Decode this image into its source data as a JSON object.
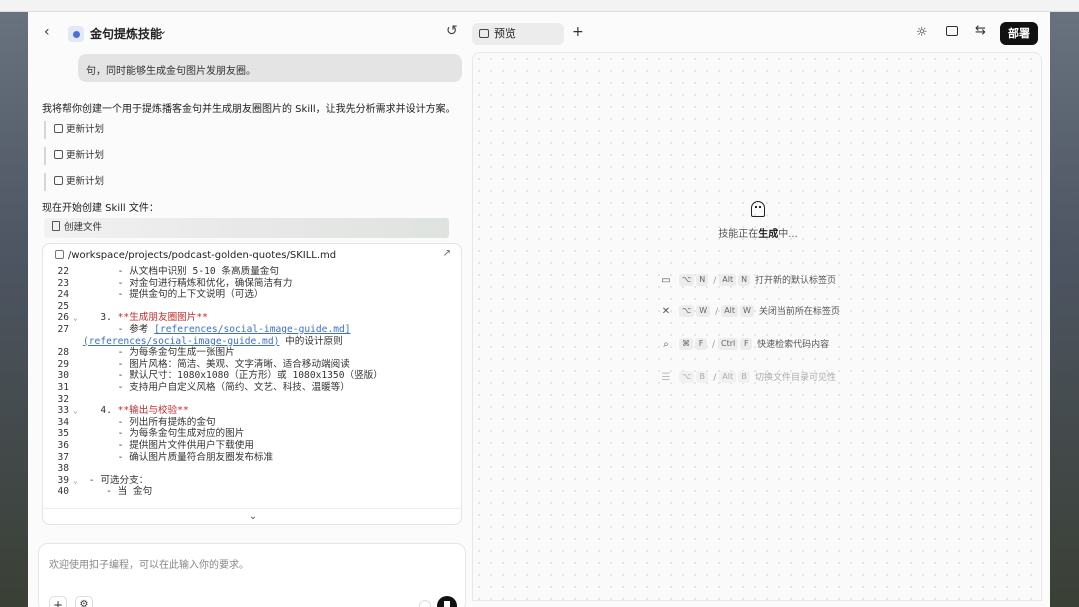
{
  "window": {
    "skill_title": "金句提炼技能"
  },
  "chat": {
    "user_bubble": "句，同时能够生成金句图片发朋友圈。",
    "assistant_text": "我将帮你创建一个用于提炼播客金句并生成朋友圈图片的 Skill，让我先分析需求并设计方案。",
    "plan_items": [
      "更新计划",
      "更新计划",
      "更新计划"
    ],
    "start_text": "现在开始创建 Skill 文件：",
    "create_file": "创建文件"
  },
  "code": {
    "file_path": "/workspace/projects/podcast-golden-quotes/SKILL.md",
    "lines": [
      {
        "n": "22",
        "fold": "",
        "text": "      - 从文档中识别 5-10 条高质量金句"
      },
      {
        "n": "23",
        "fold": "",
        "text": "      - 对金句进行精炼和优化，确保简洁有力"
      },
      {
        "n": "24",
        "fold": "",
        "text": "      - 提供金句的上下文说明（可选）"
      },
      {
        "n": "25",
        "fold": "",
        "text": ""
      },
      {
        "n": "26",
        "fold": "⌄",
        "pre": "   3. ",
        "md": "**生成朋友圈图片**",
        "text": ""
      },
      {
        "n": "27",
        "fold": "",
        "pre": "      - 参考 ",
        "link": "[references/social-image-guide.md]",
        "text": ""
      },
      {
        "n": "",
        "fold": "",
        "pre": "",
        "link": "(references/social-image-guide.md)",
        "text": " 中的设计原则"
      },
      {
        "n": "28",
        "fold": "",
        "text": "      - 为每条金句生成一张图片"
      },
      {
        "n": "29",
        "fold": "",
        "text": "      - 图片风格：简洁、美观、文字清晰、适合移动端阅读"
      },
      {
        "n": "30",
        "fold": "",
        "text": "      - 默认尺寸：1080x1080（正方形）或 1080x1350（竖版）"
      },
      {
        "n": "31",
        "fold": "",
        "text": "      - 支持用户自定义风格（简约、文艺、科技、温暖等）"
      },
      {
        "n": "32",
        "fold": "",
        "text": ""
      },
      {
        "n": "33",
        "fold": "⌄",
        "pre": "   4. ",
        "md": "**输出与校验**",
        "text": ""
      },
      {
        "n": "34",
        "fold": "",
        "text": "      - 列出所有提炼的金句"
      },
      {
        "n": "35",
        "fold": "",
        "text": "      - 为每条金句生成对应的图片"
      },
      {
        "n": "36",
        "fold": "",
        "text": "      - 提供图片文件供用户下载使用"
      },
      {
        "n": "37",
        "fold": "",
        "text": "      - 确认图片质量符合朋友圈发布标准"
      },
      {
        "n": "38",
        "fold": "",
        "text": ""
      },
      {
        "n": "39",
        "fold": "⌄",
        "text": " - 可选分支："
      },
      {
        "n": "40",
        "fold": "",
        "text": "    - 当 金句"
      }
    ]
  },
  "input": {
    "placeholder": "欢迎使用扣子编程，可以在此输入你的要求。"
  },
  "right": {
    "preview_tab": "预览",
    "deploy_label": "部署",
    "generating_prefix": "技能正在",
    "generating_bold": "生成",
    "generating_suffix": "中...",
    "shortcuts": [
      {
        "keys": [
          "⌥",
          "N"
        ],
        "alt": [
          "Alt",
          "N"
        ],
        "label": "打开新的默认标签页"
      },
      {
        "keys": [
          "⌥",
          "W"
        ],
        "alt": [
          "Alt",
          "W"
        ],
        "label": "关闭当前所在标签页"
      },
      {
        "keys": [
          "⌘",
          "F"
        ],
        "alt": [
          "Ctrl",
          "F"
        ],
        "label": "快速检索代码内容"
      },
      {
        "keys": [
          "⌥",
          "B"
        ],
        "alt": [
          "Alt",
          "B"
        ],
        "label": "切换文件目录可见性"
      }
    ]
  },
  "colors": {
    "accent_dark": "#111111",
    "markdown_bold": "#c92a2a",
    "link": "#3b6fd1"
  }
}
